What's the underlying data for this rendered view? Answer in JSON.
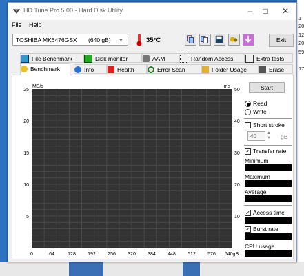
{
  "window": {
    "title": "HD Tune Pro 5.00 - Hard Disk Utility"
  },
  "menu": [
    "File",
    "Help"
  ],
  "toolbar": {
    "drive": "TOSHIBA MK6476GSX",
    "drive_size": "(640 gB)",
    "temperature": "35°C",
    "exit_label": "Exit"
  },
  "tabs_top": [
    {
      "label": "File Benchmark",
      "icon": "file-benchmark-icon"
    },
    {
      "label": "Disk monitor",
      "icon": "disk-monitor-icon"
    },
    {
      "label": "AAM",
      "icon": "speaker-icon"
    },
    {
      "label": "Random Access",
      "icon": "random-access-icon"
    },
    {
      "label": "Extra tests",
      "icon": "extra-tests-icon"
    }
  ],
  "tabs_bottom": [
    {
      "label": "Benchmark",
      "icon": "benchmark-icon",
      "active": true
    },
    {
      "label": "Info",
      "icon": "info-icon"
    },
    {
      "label": "Health",
      "icon": "health-cross-icon"
    },
    {
      "label": "Error Scan",
      "icon": "magnifier-icon"
    },
    {
      "label": "Folder Usage",
      "icon": "folder-icon"
    },
    {
      "label": "Erase",
      "icon": "trash-icon"
    }
  ],
  "chart": {
    "left_unit": "MB/s",
    "right_unit": "ms",
    "left_ticks": [
      "25",
      "20",
      "15",
      "10",
      "5"
    ],
    "right_ticks": [
      "50",
      "40",
      "30",
      "20",
      "10"
    ],
    "x_ticks": [
      "0",
      "64",
      "128",
      "192",
      "256",
      "320",
      "384",
      "448",
      "512",
      "576",
      "640gB"
    ],
    "background": "#333333",
    "grid": "#4a4a4a"
  },
  "chart_data": {
    "type": "line",
    "series": [],
    "xlabel": "",
    "ylabel": "MB/s",
    "y2label": "ms",
    "xlim": [
      0,
      640
    ],
    "ylim": [
      0,
      25
    ],
    "y2lim": [
      0,
      50
    ],
    "grid": true
  },
  "controls": {
    "start_label": "Start",
    "read_label": "Read",
    "write_label": "Write",
    "short_stroke_label": "Short stroke",
    "stroke_value": "40",
    "stroke_unit": "gB",
    "transfer_rate_label": "Transfer rate",
    "minimum_label": "Minimum",
    "maximum_label": "Maximum",
    "average_label": "Average",
    "access_time_label": "Access time",
    "burst_rate_label": "Burst rate",
    "cpu_usage_label": "CPU usage"
  },
  "desktop": {
    "right_edge_text": [
      "1",
      "20",
      "12",
      "20",
      "59",
      "17"
    ]
  }
}
